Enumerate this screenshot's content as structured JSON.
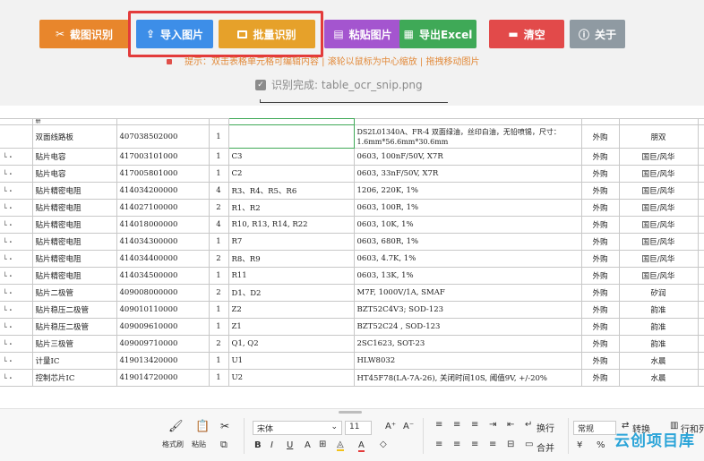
{
  "toolbar": {
    "snip_label": "截图识别",
    "import_label": "导入图片",
    "batch_label": "批量识别",
    "paste_label": "粘贴图片",
    "export_label": "导出Excel",
    "clear_label": "清空",
    "about_label": "关于"
  },
  "hint_text": "提示：双击表格单元格可编辑内容 | 滚轮以鼠标为中心缩放 | 拖拽移动图片",
  "status_text": "识别完成: table_ocr_snip.png",
  "table": {
    "top_fragment": "册",
    "rows": [
      {
        "c0": "",
        "name": "双面线路板",
        "code": "407038502000",
        "qty": "1",
        "ref": "",
        "spec": "DS2L01340A、FR-4 双面绿油，丝印白油，无铅喷锡，尺寸：1.6mm*56.6mm*30.6mm",
        "src": "外购",
        "brand": "朋双"
      },
      {
        "c0": "└・",
        "name": "贴片电容",
        "code": "417003101000",
        "qty": "1",
        "ref": "C3",
        "spec": "0603, 100nF/50V, X7R",
        "src": "外购",
        "brand": "国巨/风华"
      },
      {
        "c0": "└・",
        "name": "贴片电容",
        "code": "417005801000",
        "qty": "1",
        "ref": "C2",
        "spec": "0603, 33nF/50V, X7R",
        "src": "外购",
        "brand": "国巨/风华"
      },
      {
        "c0": "└・",
        "name": "贴片精密电阻",
        "code": "414034200000",
        "qty": "4",
        "ref": "R3、R4、R5、R6",
        "spec": "1206, 220K, 1%",
        "src": "外购",
        "brand": "国巨/风华"
      },
      {
        "c0": "└・",
        "name": "贴片精密电阻",
        "code": "414027100000",
        "qty": "2",
        "ref": "R1、R2",
        "spec": "0603, 100R, 1%",
        "src": "外购",
        "brand": "国巨/风华"
      },
      {
        "c0": "└・",
        "name": "贴片精密电阻",
        "code": "414018000000",
        "qty": "4",
        "ref": "R10, R13, R14, R22",
        "spec": "0603, 10K, 1%",
        "src": "外购",
        "brand": "国巨/风华"
      },
      {
        "c0": "└・",
        "name": "贴片精密电阻",
        "code": "414034300000",
        "qty": "1",
        "ref": "R7",
        "spec": "0603, 680R, 1%",
        "src": "外购",
        "brand": "国巨/风华"
      },
      {
        "c0": "└・",
        "name": "贴片精密电阻",
        "code": "414034400000",
        "qty": "2",
        "ref": "R8、R9",
        "spec": "0603, 4.7K, 1%",
        "src": "外购",
        "brand": "国巨/风华"
      },
      {
        "c0": "└・",
        "name": "贴片精密电阻",
        "code": "414034500000",
        "qty": "1",
        "ref": "R11",
        "spec": "0603, 13K, 1%",
        "src": "外购",
        "brand": "国巨/风华"
      },
      {
        "c0": "└・",
        "name": "贴片二极管",
        "code": "409008000000",
        "qty": "2",
        "ref": "D1、D2",
        "spec": "M7F, 1000V/1A, SMAF",
        "src": "外购",
        "brand": "矽润"
      },
      {
        "c0": "└・",
        "name": "贴片稳压二极管",
        "code": "409010110000",
        "qty": "1",
        "ref": "Z2",
        "spec": "BZT52C4V3; SOD-123",
        "src": "外购",
        "brand": "韵准"
      },
      {
        "c0": "└・",
        "name": "贴片稳压二极管",
        "code": "409009610000",
        "qty": "1",
        "ref": "Z1",
        "spec": "BZT52C24 , SOD-123",
        "src": "外购",
        "brand": "韵准"
      },
      {
        "c0": "└・",
        "name": "贴片三极管",
        "code": "409009710000",
        "qty": "2",
        "ref": "Q1, Q2",
        "spec": "2SC1623, SOT-23",
        "src": "外购",
        "brand": "韵准"
      },
      {
        "c0": "└・",
        "name": "计量IC",
        "code": "419013420000",
        "qty": "1",
        "ref": "U1",
        "spec": "HLW8032",
        "src": "外购",
        "brand": "水晨"
      },
      {
        "c0": "└・",
        "name": "控制芯片IC",
        "code": "419014720000",
        "qty": "1",
        "ref": "U2",
        "spec": "HT45F78(LA-7A-26), 关闭时间10S, 阈值9V, +/-20%",
        "src": "外购",
        "brand": "水晨"
      }
    ]
  },
  "ribbon": {
    "format_painter": "格式刷",
    "paste": "粘贴",
    "font_name": "宋体",
    "font_size": "11",
    "wrap_text": "换行",
    "merge": "合并",
    "number_format": "常规",
    "convert": "转换",
    "rows_cols": "行和列",
    "grow_font": "A⁺",
    "shrink_font": "A⁻"
  },
  "watermark": "云创项目库"
}
